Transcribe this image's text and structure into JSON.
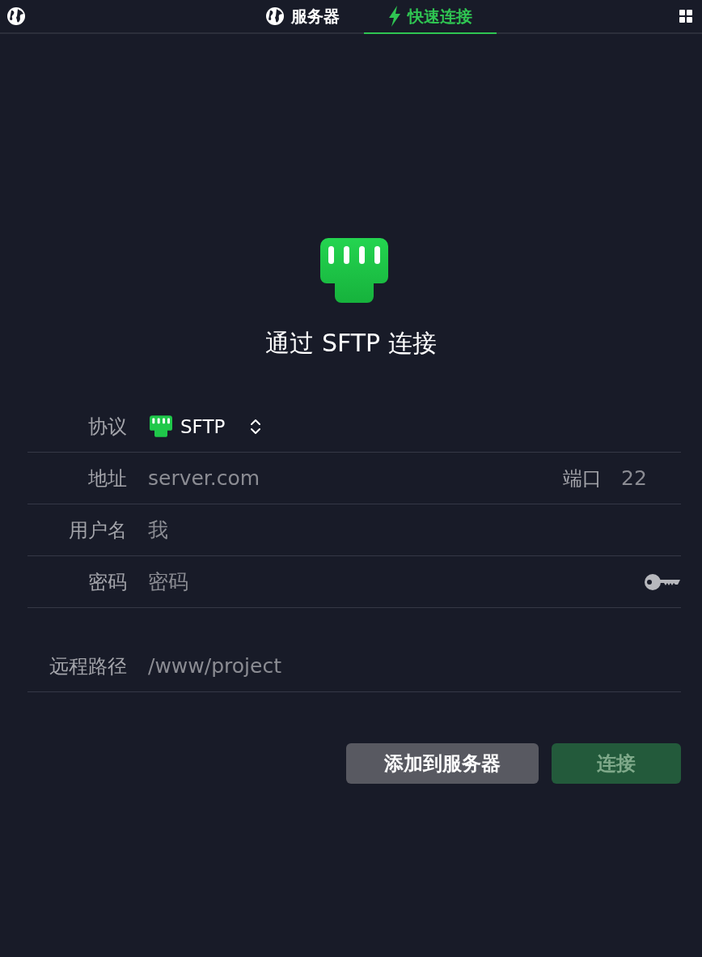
{
  "tabs": [
    {
      "label": "服务器",
      "kind": "servers",
      "selected": false
    },
    {
      "label": "快速连接",
      "kind": "quick",
      "selected": true
    }
  ],
  "heading": "通过 SFTP 连接",
  "protocol": {
    "label": "协议",
    "value": "SFTP"
  },
  "fields": [
    {
      "kind": "address",
      "label": "地址",
      "placeholder": "server.com",
      "port_label": "端口",
      "port_placeholder": "22"
    },
    {
      "kind": "text",
      "label": "用户名",
      "placeholder": "我"
    },
    {
      "kind": "password",
      "label": "密码",
      "placeholder": "密码"
    }
  ],
  "remote_path": {
    "label": "远程路径",
    "placeholder": "/www/project"
  },
  "buttons": [
    {
      "label": "添加到服务器",
      "kind": "secondary",
      "disabled": false
    },
    {
      "label": "连接",
      "kind": "primary",
      "disabled": true
    }
  ]
}
